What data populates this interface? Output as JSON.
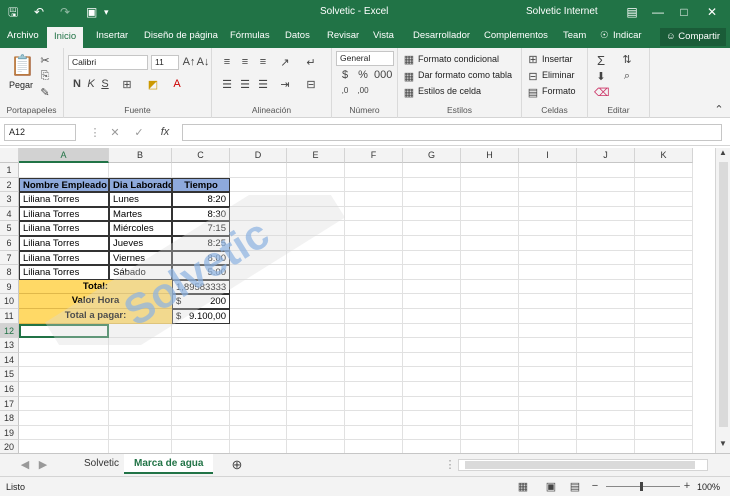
{
  "title_bar": {
    "doc_title": "Solvetic  -  Excel",
    "account": "Solvetic Internet"
  },
  "tabs": [
    "Archivo",
    "Inicio",
    "Insertar",
    "Diseño de página",
    "Fórmulas",
    "Datos",
    "Revisar",
    "Vista",
    "Desarrollador",
    "Complementos",
    "Team"
  ],
  "active_tab": "Inicio",
  "tell_me": "Indicar",
  "share": "Compartir",
  "ribbon": {
    "paste": "Pegar",
    "clipboard_label": "Portapapeles",
    "font_name": "Calibri",
    "font_size": "11",
    "font_label": "Fuente",
    "align_label": "Alineación",
    "number_format": "General",
    "number_label": "Número",
    "cond_format": "Formato condicional",
    "table_format": "Dar formato como tabla",
    "cell_styles": "Estilos de celda",
    "styles_label": "Estilos",
    "insert": "Insertar",
    "delete": "Eliminar",
    "format": "Formato",
    "cells_label": "Celdas",
    "edit_label": "Editar"
  },
  "formula_bar": {
    "name_box": "A12",
    "fx": "fx",
    "formula": ""
  },
  "columns": [
    "A",
    "B",
    "C",
    "D",
    "E",
    "F",
    "G",
    "H",
    "I",
    "J",
    "K"
  ],
  "rows": [
    "1",
    "2",
    "3",
    "4",
    "5",
    "6",
    "7",
    "8",
    "9",
    "10",
    "11",
    "12",
    "13",
    "14",
    "15",
    "16",
    "17",
    "18",
    "19",
    "20"
  ],
  "table": {
    "headers": [
      "Nombre Empleado",
      "Dia Laborado",
      "Tiempo"
    ],
    "data": [
      [
        "Liliana Torres",
        "Lunes",
        "8:20"
      ],
      [
        "Liliana Torres",
        "Martes",
        "8:30"
      ],
      [
        "Liliana Torres",
        "Miércoles",
        "7:15"
      ],
      [
        "Liliana Torres",
        "Jueves",
        "8:25"
      ],
      [
        "Liliana Torres",
        "Viernes",
        "8:00"
      ],
      [
        "Liliana Torres",
        "Sábado",
        "5:00"
      ]
    ],
    "total_label": "Total:",
    "total_value": "1,89583333",
    "rate_label": "Valor Hora",
    "rate_currency": "$",
    "rate_value": "200",
    "pay_label": "Total a pagar:",
    "pay_currency": "$",
    "pay_value": "9.100,00"
  },
  "watermark": "Solvetic",
  "sheets": [
    "Solvetic",
    "Marca de agua"
  ],
  "active_sheet": "Marca de agua",
  "status": {
    "ready": "Listo",
    "zoom": "100%"
  }
}
